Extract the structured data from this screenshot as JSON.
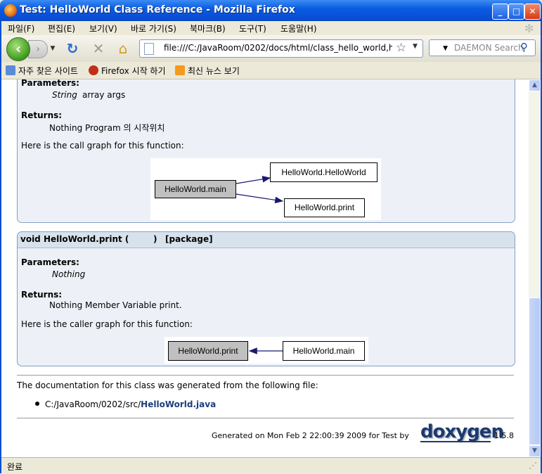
{
  "window": {
    "title": "Test: HelloWorld Class Reference - Mozilla Firefox"
  },
  "menu": [
    "파일(F)",
    "편집(E)",
    "보기(V)",
    "바로 가기(S)",
    "북마크(B)",
    "도구(T)",
    "도움말(H)"
  ],
  "url": "file:///C:/JavaRoom/0202/docs/html/class_hello_world,h",
  "search_placeholder": "DAEMON Search",
  "bookmarks": [
    "자주 찾은 사이트",
    "Firefox 시작 하기",
    "최신 뉴스 보기"
  ],
  "doc": {
    "block1": {
      "params_label": "Parameters:",
      "param_type": "String",
      "param_text": "array args",
      "returns_label": "Returns:",
      "returns_text": "Nothing Program 의 시작위치",
      "graph_caption": "Here is the call graph for this function:",
      "graph_nodes": {
        "main": "HelloWorld.main",
        "ctor": "HelloWorld.HelloWorld",
        "print": "HelloWorld.print"
      }
    },
    "block2": {
      "proto_name": "void HelloWorld.print (",
      "proto_close": ")",
      "proto_tag": "[package]",
      "params_label": "Parameters:",
      "param_text": "Nothing",
      "returns_label": "Returns:",
      "returns_text": "Nothing Member Variable print.",
      "graph_caption": "Here is the caller graph for this function:",
      "graph_nodes": {
        "print": "HelloWorld.print",
        "main": "HelloWorld.main"
      }
    },
    "footer_intro": "The documentation for this class was generated from the following file:",
    "file_path": "C:/JavaRoom/0202/src/",
    "file_link": "HelloWorld.java",
    "generated": "Generated on Mon Feb 2 22:00:39 2009 for Test by",
    "doxygen_logo": "doxygen",
    "doxygen_version": "1.5.8"
  },
  "status": "완료",
  "colors": {
    "titlebar": "#0a5ce0",
    "memdoc_bg": "#edf1f7",
    "memdoc_border": "#84a0c4",
    "link": "#1a3e7e",
    "graph_arrow": "#191970"
  }
}
